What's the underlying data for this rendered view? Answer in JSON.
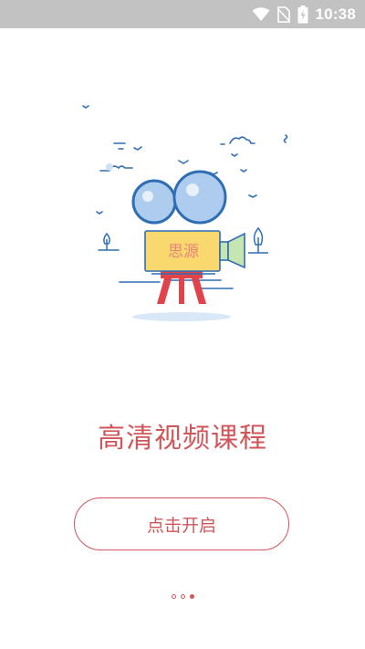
{
  "status_bar": {
    "time": "10:38",
    "icons": [
      "wifi-icon",
      "no-sim-icon",
      "battery-charging-icon"
    ]
  },
  "illustration": {
    "label": "思源",
    "icon": "film-camera-icon"
  },
  "onboarding": {
    "headline": "高清视频课程",
    "button_label": "点击开启"
  },
  "pager": {
    "total_pages": 3,
    "active_page": 3
  },
  "colors": {
    "accent": "#d0565a",
    "status_bar": "#c2c2c2",
    "camera_blue": "#2f6db5",
    "camera_yellow": "#f9d86e"
  }
}
